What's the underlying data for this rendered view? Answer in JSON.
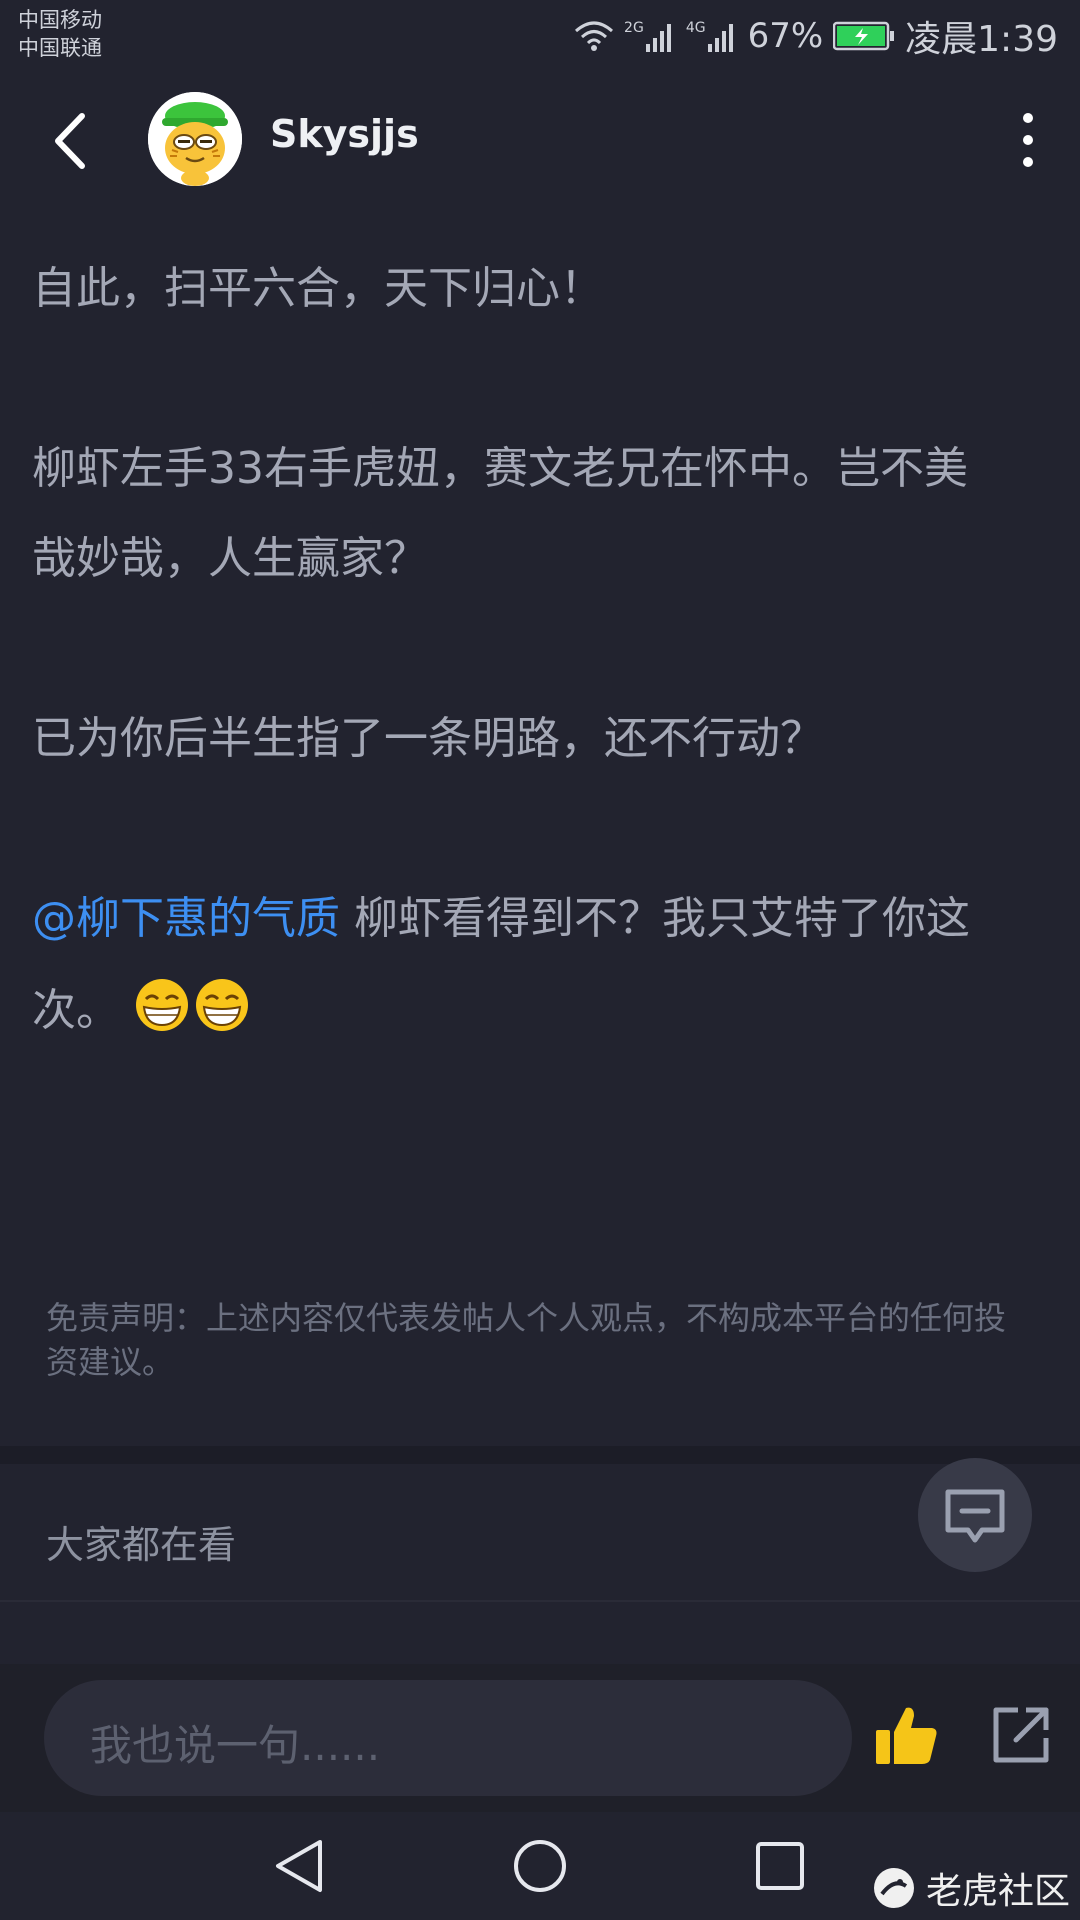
{
  "status_bar": {
    "carrier_1": "中国移动",
    "carrier_2": "中国联通",
    "signal_1_label": "2G",
    "signal_2_label": "4G",
    "battery": "67%",
    "time": "凌晨1:39"
  },
  "header": {
    "username": "Skysjjs"
  },
  "post": {
    "line_1": "自此，扫平六合，天下归心！",
    "line_2": "柳虾左手33右手虎妞，赛文老兄在怀中。岂不美",
    "line_3": "哉妙哉，人生赢家？",
    "line_4": "已为你后半生指了一条明路，还不行动？",
    "mention": "@柳下惠的气质",
    "line_5_rest": " 柳虾看得到不？我只艾特了你这",
    "line_6": "次。"
  },
  "disclaimer": "免责声明：上述内容仅代表发帖人个人观点，不构成本平台的任何投资建议。",
  "section": {
    "title": "大家都在看"
  },
  "comment_bar": {
    "placeholder": "我也说一句......"
  },
  "watermark": {
    "text": "老虎社区"
  },
  "colors": {
    "background": "#22232f",
    "mention": "#3d8ff2",
    "like": "#f5c518",
    "battery": "#2fd05a"
  }
}
